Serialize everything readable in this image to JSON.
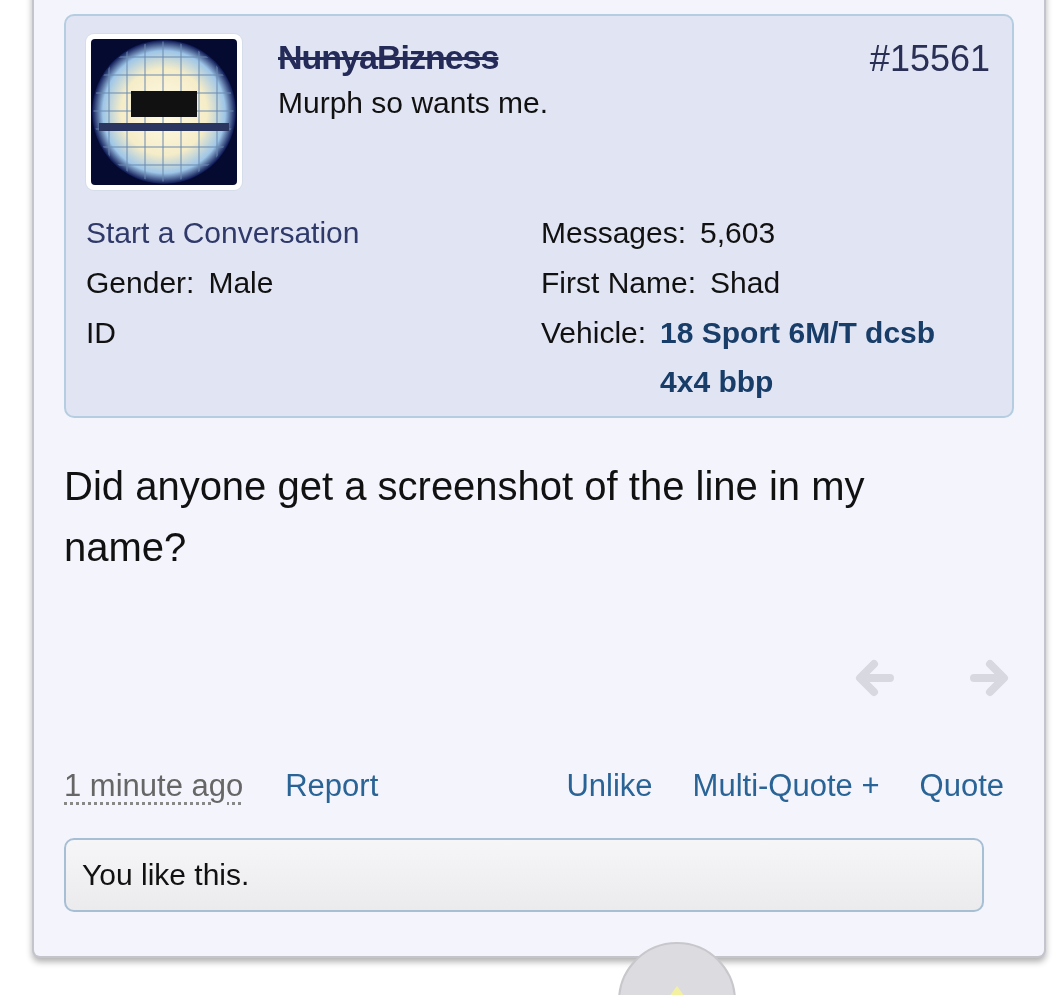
{
  "post": {
    "number": "#15561",
    "message": "Did anyone get a screenshot of the line in my name?",
    "time": "1 minute ago"
  },
  "user": {
    "name": "NunyaBizness",
    "struck_out": true,
    "title": "Murph so wants me."
  },
  "user_info_left": [
    {
      "kind": "link",
      "text": "Start a Conversation"
    },
    {
      "kind": "pair",
      "label": "Gender:",
      "value": "Male"
    },
    {
      "kind": "plain",
      "text": "ID"
    }
  ],
  "user_info_right": [
    {
      "kind": "pair",
      "label": "Messages:",
      "value": "5,603"
    },
    {
      "kind": "pair",
      "label": "First Name:",
      "value": "Shad"
    },
    {
      "kind": "strong_pair",
      "label": "Vehicle:",
      "value": "18 Sport 6M/T dcsb 4x4 bbp"
    }
  ],
  "nav": [
    {
      "kind": "prev",
      "disabled": true
    },
    {
      "kind": "next",
      "disabled": true
    }
  ],
  "actions_left": [
    "Report"
  ],
  "actions_right": [
    "Unlike",
    "Multi-Quote +",
    "Quote"
  ],
  "likes": "You like this."
}
